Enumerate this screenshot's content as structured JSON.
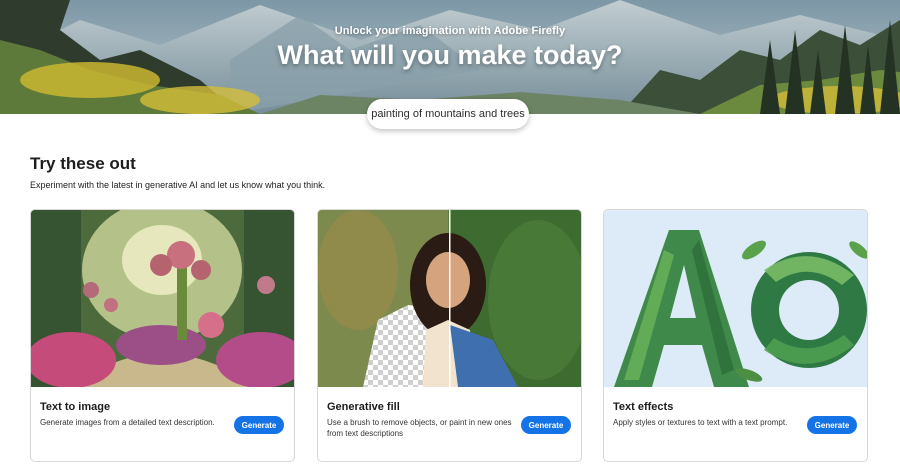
{
  "hero": {
    "subtitle": "Unlock your imagination with Adobe Firefly",
    "title": "What will you make today?",
    "prompt_value": "painting of mountains and trees"
  },
  "section": {
    "title": "Try these out",
    "subtitle": "Experiment with the latest in generative AI and let us know what you think."
  },
  "cards": [
    {
      "title": "Text to image",
      "description": "Generate images from a detailed text description.",
      "button": "Generate"
    },
    {
      "title": "Generative fill",
      "description": "Use a brush to remove objects, or paint in new ones from text descriptions",
      "button": "Generate"
    },
    {
      "title": "Text effects",
      "description": "Apply styles or textures to text with a text prompt.",
      "button": "Generate"
    }
  ],
  "colors": {
    "accent": "#1473e6",
    "text_effects_letters": "AO"
  }
}
